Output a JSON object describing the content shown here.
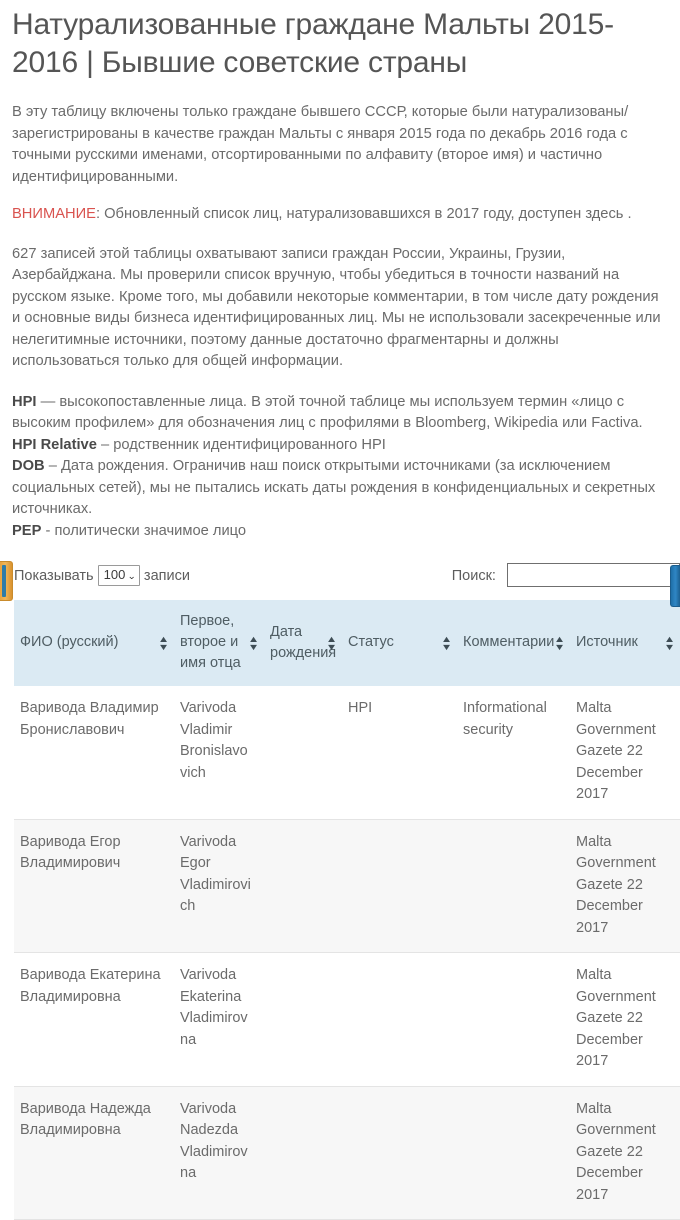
{
  "page": {
    "title": "Натурализованные граждане Мальты 2015-2016 | Бывшие советские страны",
    "intro": "В эту таблицу включены только граждане бывшего СССР, которые были натурализованы/зарегистрированы в качестве граждан Мальты с января 2015 года по декабрь 2016 года с точными русскими именами, отсортированными по алфавиту (второе имя) и частично идентифицированными.",
    "notice_word": "ВНИМАНИЕ",
    "notice_rest": ": Обновленный список лиц, натурализовавшихся в 2017 году, доступен здесь .",
    "paragraph": "627 записей этой таблицы охватывают записи граждан России, Украины, Грузии, Азербайджана. Мы проверили список вручную, чтобы убедиться в точности названий на русском языке. Кроме того, мы добавили некоторые комментарии, в том числе дату рождения и основные виды бизнеса идентифицированных лиц. Мы не использовали засекреченные или нелегитимные источники, поэтому данные достаточно фрагментарны и должны использоваться только для общей информации."
  },
  "definitions": [
    {
      "term": "HPI",
      "text": " — высокопоставленные лица. В этой точной таблице мы используем термин «лицо с высоким профилем» для обозначения лиц с профилями в Bloomberg, Wikipedia или Factiva."
    },
    {
      "term": "HPI Relative",
      "text": " – родственник идентифицированного HPI"
    },
    {
      "term": "DOB",
      "text": " – Дата рождения. Ограничив наш поиск открытыми источниками (за исключением социальных сетей), мы не пытались искать даты рождения в конфиденциальных и секретных источниках."
    },
    {
      "term": "PEP",
      "text": " - политически значимое лицо"
    }
  ],
  "controls": {
    "length_prefix": "Показывать",
    "length_value": "100",
    "length_suffix": "записи",
    "length_caret": "⌄",
    "search_label": "Поиск:",
    "search_value": "",
    "search_placeholder": ""
  },
  "table": {
    "headers": [
      "ФИО (русский)",
      "Первое, второе и имя отца",
      "Дата рождения",
      "Статус",
      "Комментарии",
      "Источник"
    ],
    "sort_up": "▲",
    "sort_down": "▼",
    "rows": [
      {
        "name_ru": "Варивода Владимир Брониславович",
        "name_en": "Varivoda Vladimir Bronislavovich",
        "dob": "",
        "status": "HPI",
        "comments": "Informational security",
        "source": "Malta Government Gazete 22 December 2017"
      },
      {
        "name_ru": "Варивода Егор Владимирович",
        "name_en": "Varivoda Egor Vladimirovich",
        "dob": "",
        "status": "",
        "comments": "",
        "source": "Malta Government Gazete 22 December 2017"
      },
      {
        "name_ru": "Варивода Екатерина Владимировна",
        "name_en": "Varivoda Ekaterina Vladimirovna",
        "dob": "",
        "status": "",
        "comments": "",
        "source": "Malta Government Gazete 22 December 2017"
      },
      {
        "name_ru": "Варивода Надежда Владимировна",
        "name_en": "Varivoda Nadezda Vladimirovna",
        "dob": "",
        "status": "",
        "comments": "",
        "source": "Malta Government Gazete 22 December 2017"
      }
    ]
  },
  "colors": {
    "header_bg": "#dbeaf3",
    "notice": "#d9534f",
    "text": "#6b6b6b",
    "share_left": "#e8a33d",
    "share_right": "#2f86c4"
  }
}
